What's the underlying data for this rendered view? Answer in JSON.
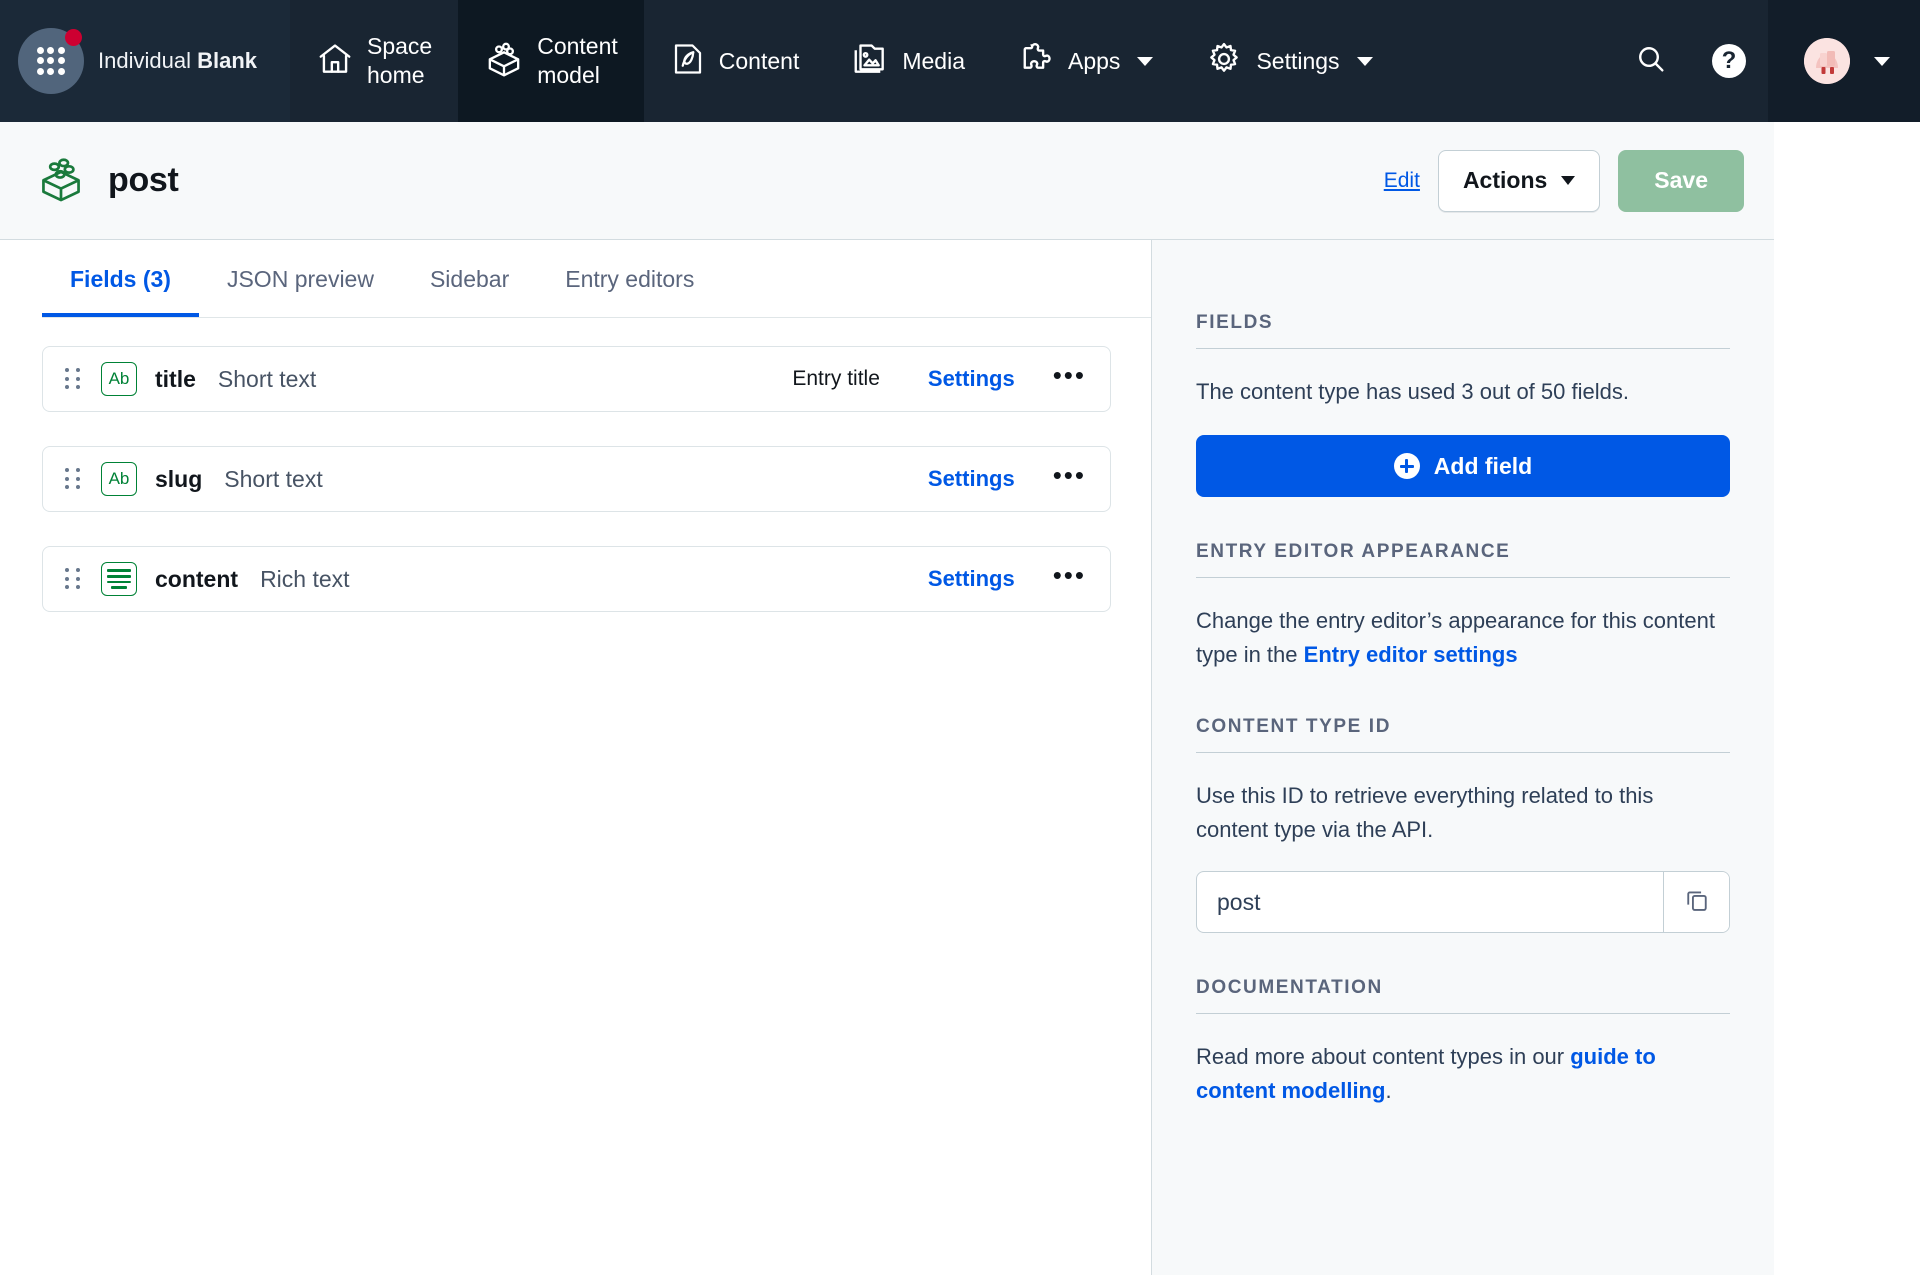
{
  "topnav": {
    "org": {
      "line1": "Individual",
      "line2": "Blank",
      "logo_icon": "grid-dots-icon",
      "badge_icon": "notification-dot-icon",
      "menu_icon": "hamburger-icon"
    },
    "items": [
      {
        "id": "space-home",
        "label_line1": "Space",
        "label_line2": "home",
        "icon": "home-icon",
        "active": false,
        "has_caret": false
      },
      {
        "id": "content-model",
        "label_line1": "Content",
        "label_line2": "model",
        "icon": "content-model-icon",
        "active": true,
        "has_caret": false
      },
      {
        "id": "content",
        "label_line1": "Content",
        "label_line2": "",
        "icon": "content-pen-icon",
        "active": false,
        "has_caret": false
      },
      {
        "id": "media",
        "label_line1": "Media",
        "label_line2": "",
        "icon": "media-image-icon",
        "active": false,
        "has_caret": false
      },
      {
        "id": "apps",
        "label_line1": "Apps",
        "label_line2": "",
        "icon": "puzzle-icon",
        "active": false,
        "has_caret": true
      },
      {
        "id": "settings",
        "label_line1": "Settings",
        "label_line2": "",
        "icon": "gear-icon",
        "active": false,
        "has_caret": true
      }
    ],
    "search_icon": "search-icon",
    "help_label": "?",
    "help_icon": "help-question-icon",
    "avatar_icon": "user-avatar-icon",
    "user_caret_icon": "chevron-down-icon"
  },
  "header": {
    "icon": "content-type-block-icon",
    "title": "post",
    "edit_label": "Edit",
    "actions_label": "Actions",
    "actions_caret_icon": "chevron-down-icon",
    "save_label": "Save"
  },
  "tabs": [
    {
      "id": "fields",
      "label": "Fields (3)",
      "active": true
    },
    {
      "id": "json-preview",
      "label": "JSON preview",
      "active": false
    },
    {
      "id": "sidebar",
      "label": "Sidebar",
      "active": false
    },
    {
      "id": "entry-editors",
      "label": "Entry editors",
      "active": false
    }
  ],
  "fields": [
    {
      "name": "title",
      "type": "Short text",
      "chip": "Ab",
      "chip_style": "text",
      "badge": "Entry title",
      "settings_label": "Settings",
      "more_label": "•••"
    },
    {
      "name": "slug",
      "type": "Short text",
      "chip": "Ab",
      "chip_style": "text",
      "badge": "",
      "settings_label": "Settings",
      "more_label": "•••"
    },
    {
      "name": "content",
      "type": "Rich text",
      "chip": "",
      "chip_style": "lines",
      "badge": "",
      "settings_label": "Settings",
      "more_label": "•••"
    }
  ],
  "sidebar": {
    "fields_section": {
      "title": "FIELDS",
      "description": "The content type has used 3 out of 50 fields.",
      "add_field_label": "Add field",
      "add_field_icon": "plus-circle-icon"
    },
    "entry_editor_section": {
      "title": "ENTRY EDITOR APPEARANCE",
      "text_before": "Change the entry editor’s appearance for this content type in the ",
      "link_label": "Entry editor settings",
      "text_after": ""
    },
    "content_type_id_section": {
      "title": "CONTENT TYPE ID",
      "description": "Use this ID to retrieve everything related to this content type via the API.",
      "value": "post",
      "copy_icon": "copy-icon"
    },
    "documentation_section": {
      "title": "DOCUMENTATION",
      "text_before": "Read more about content types in our ",
      "link_label": "guide to content modelling",
      "text_after": "."
    }
  },
  "colors": {
    "nav_bg": "#192532",
    "nav_active": "#0d1822",
    "accent_blue": "#0058e5",
    "save_green": "#8fc0a0",
    "chip_green": "#008236",
    "panel_bg": "#f7f9fa",
    "badge_red": "#cd0031"
  }
}
